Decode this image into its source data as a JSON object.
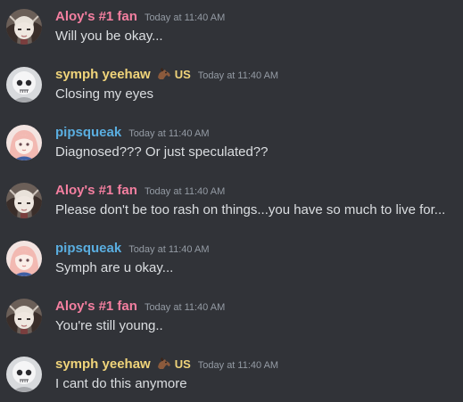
{
  "colors": {
    "background": "#313338",
    "text": "#dbdee1",
    "timestamp": "#949ba4",
    "aloy_name": "#f47fa0",
    "symph_name": "#f0d47a",
    "pip_name": "#5aaee0"
  },
  "messages": [
    {
      "username": "Aloy's #1 fan",
      "timestamp": "Today at 11:40 AM",
      "text": "Will you be okay..."
    },
    {
      "username": "symph yeehaw",
      "badge_icon": "horse-emoji-icon",
      "role": "US",
      "timestamp": "Today at 11:40 AM",
      "text": "Closing my eyes"
    },
    {
      "username": "pipsqueak",
      "timestamp": "Today at 11:40 AM",
      "text": "Diagnosed??? Or just speculated??"
    },
    {
      "username": "Aloy's #1 fan",
      "timestamp": "Today at 11:40 AM",
      "text": "Please don't be too rash on things...you have so much to live for..."
    },
    {
      "username": "pipsqueak",
      "timestamp": "Today at 11:40 AM",
      "text": "Symph are u okay..."
    },
    {
      "username": "Aloy's #1 fan",
      "timestamp": "Today at 11:40 AM",
      "text": "You're still young.."
    },
    {
      "username": "symph yeehaw",
      "badge_icon": "horse-emoji-icon",
      "role": "US",
      "timestamp": "Today at 11:40 AM",
      "text": "I cant do this anymore"
    }
  ]
}
